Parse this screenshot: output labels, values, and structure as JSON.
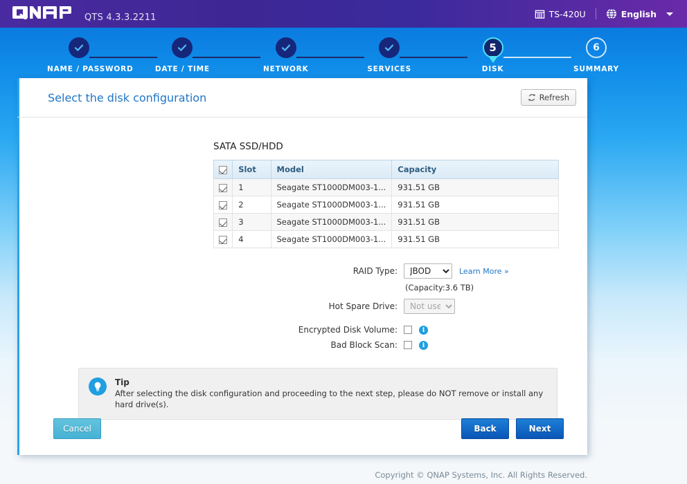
{
  "topbar": {
    "brand": "QNAP",
    "version": "QTS 4.3.3.2211",
    "nas_model": "TS-420U",
    "nas_icon": "nas-server-icon",
    "language": "English",
    "language_icon": "globe-icon",
    "caret_icon": "chevron-down-icon"
  },
  "wizard": {
    "steps": [
      {
        "number": "1",
        "label": "NAME / PASSWORD",
        "state": "done"
      },
      {
        "number": "2",
        "label": "DATE / TIME",
        "state": "done"
      },
      {
        "number": "3",
        "label": "NETWORK",
        "state": "done"
      },
      {
        "number": "4",
        "label": "SERVICES",
        "state": "done"
      },
      {
        "number": "5",
        "label": "DISK",
        "state": "active"
      },
      {
        "number": "6",
        "label": "SUMMARY",
        "state": "pending"
      }
    ]
  },
  "panel": {
    "title": "Select the disk configuration",
    "refresh_label": "Refresh",
    "refresh_icon": "refresh-icon"
  },
  "disks": {
    "section_title": "SATA SSD/HDD",
    "select_all_checked": true,
    "columns": [
      "Slot",
      "Model",
      "Capacity"
    ],
    "rows": [
      {
        "checked": true,
        "slot": "1",
        "model": "Seagate ST1000DM003-1...",
        "capacity": "931.51 GB"
      },
      {
        "checked": true,
        "slot": "2",
        "model": "Seagate ST1000DM003-1...",
        "capacity": "931.51 GB"
      },
      {
        "checked": true,
        "slot": "3",
        "model": "Seagate ST1000DM003-1...",
        "capacity": "931.51 GB"
      },
      {
        "checked": true,
        "slot": "4",
        "model": "Seagate ST1000DM003-1...",
        "capacity": "931.51 GB"
      }
    ]
  },
  "form": {
    "raid_type_label": "RAID Type:",
    "raid_type_value": "JBOD",
    "raid_type_options": [
      "JBOD"
    ],
    "learn_more": "Learn More »",
    "capacity_note": "(Capacity:3.6 TB)",
    "hot_spare_label": "Hot Spare Drive:",
    "hot_spare_value": "Not used",
    "hot_spare_options": [
      "Not used"
    ],
    "encrypted_label": "Encrypted Disk Volume:",
    "encrypted_checked": false,
    "bad_block_label": "Bad Block Scan:",
    "bad_block_checked": false,
    "info_icon": "info-icon"
  },
  "tip": {
    "icon": "lightbulb-icon",
    "title": "Tip",
    "text": "After selecting the disk configuration and proceeding to the next step, please do NOT remove or install any hard drive(s)."
  },
  "buttons": {
    "cancel": "Cancel",
    "back": "Back",
    "next": "Next"
  },
  "footer": {
    "copyright": "Copyright © QNAP Systems, Inc. All Rights Reserved."
  },
  "colors": {
    "header_purple": "#3d2794",
    "accent_blue": "#2076c8",
    "active_step_ring": "#4fe0f5",
    "info_blue": "#1f9fe0",
    "primary_button": "#0a56b8",
    "cancel_button": "#46b2d4"
  }
}
